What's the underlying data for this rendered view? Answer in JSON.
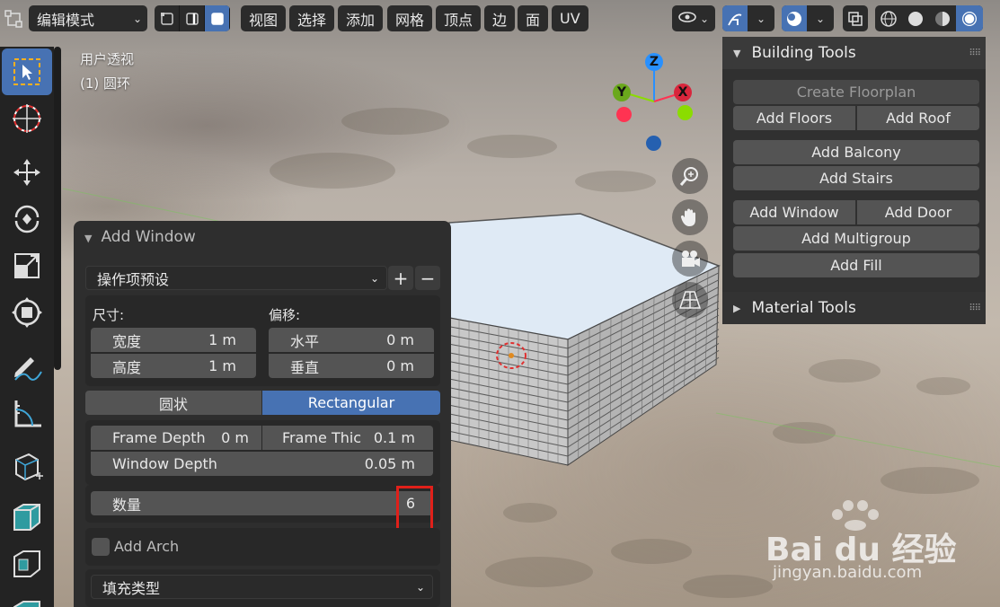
{
  "header": {
    "mode_label": "编辑模式",
    "menus": [
      "视图",
      "选择",
      "添加",
      "网格",
      "顶点",
      "边",
      "面",
      "UV"
    ]
  },
  "viewport": {
    "view_name": "用户透视",
    "object_label": "(1) 圆环"
  },
  "gizmo": {
    "axes": [
      "Z",
      "Y",
      "X"
    ]
  },
  "building_tools": {
    "title": "Building Tools",
    "create_floorplan": "Create Floorplan",
    "add_floors": "Add Floors",
    "add_roof": "Add Roof",
    "add_balcony": "Add Balcony",
    "add_stairs": "Add Stairs",
    "add_window": "Add Window",
    "add_door": "Add Door",
    "add_multigroup": "Add Multigroup",
    "add_fill": "Add Fill"
  },
  "material_tools": {
    "title": "Material Tools"
  },
  "add_window_panel": {
    "title": "Add Window",
    "preset_label": "操作项预设",
    "size_label": "尺寸:",
    "offset_label": "偏移:",
    "width_label": "宽度",
    "width_value": "1 m",
    "height_label": "高度",
    "height_value": "1 m",
    "horizontal_label": "水平",
    "horizontal_value": "0 m",
    "vertical_label": "垂直",
    "vertical_value": "0 m",
    "type_options": [
      "圆状",
      "Rectangular"
    ],
    "type_selected": "Rectangular",
    "frame_depth_label": "Frame Depth",
    "frame_depth_value": "0 m",
    "frame_thickness_label": "Frame Thic",
    "frame_thickness_value": "0.1 m",
    "window_depth_label": "Window Depth",
    "window_depth_value": "0.05 m",
    "count_label": "数量",
    "count_value": "6",
    "add_arch_label": "Add Arch",
    "add_arch_checked": false,
    "fill_type_label": "填充类型"
  },
  "watermark": {
    "brand": "Bai du 经验",
    "url": "jingyan.baidu.com"
  },
  "colors": {
    "accent_blue": "#4772b3",
    "highlight_red": "#e0201a",
    "axis_x": "#ff3352",
    "axis_y": "#8bdc00",
    "axis_z": "#2890ff"
  }
}
